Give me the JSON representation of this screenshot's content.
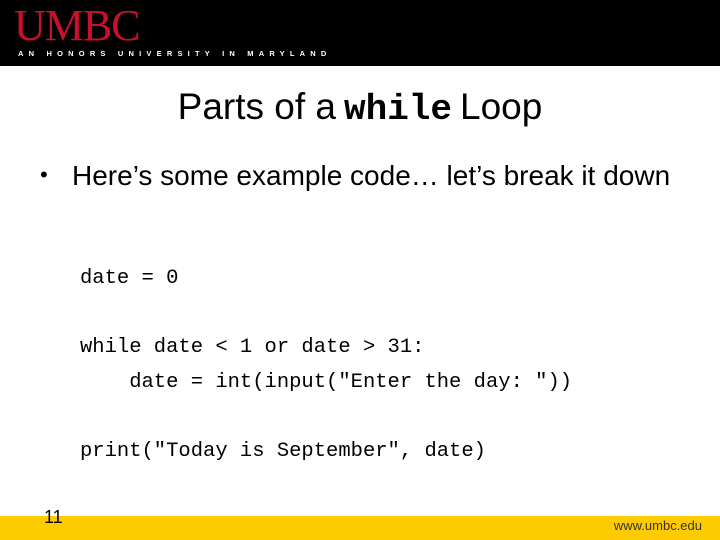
{
  "header": {
    "logo": "UMBC",
    "tagline": "AN HONORS UNIVERSITY IN MARYLAND",
    "colors": {
      "background": "#000000",
      "logo": "#c8102e"
    }
  },
  "slide": {
    "title_prefix": "Parts of a",
    "title_code": "while",
    "title_suffix": "Loop",
    "bullet": "Here’s some example code… let’s break it down",
    "code_lines": [
      "date = 0",
      "",
      "while date < 1 or date > 31:",
      "    date = int(input(\"Enter the day: \"))",
      "",
      "print(\"Today is September\", date)"
    ]
  },
  "footer": {
    "page_number": "11",
    "url": "www.umbc.edu",
    "color": "#fdcb00"
  }
}
